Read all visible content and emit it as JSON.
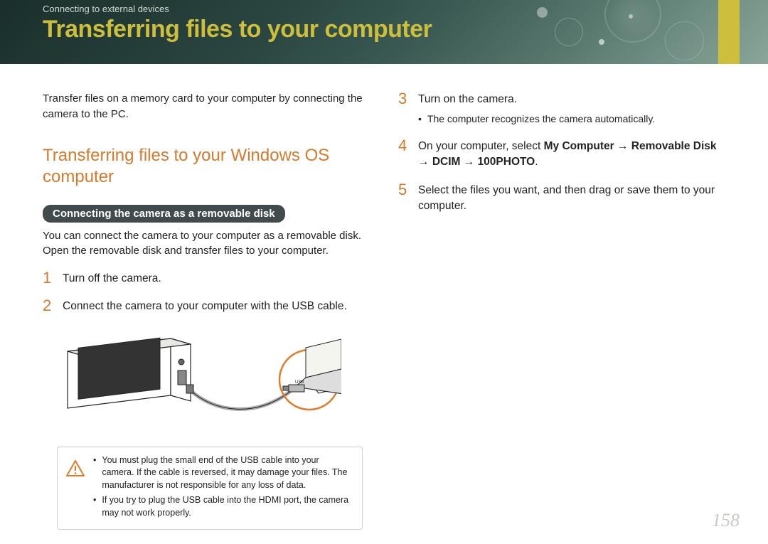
{
  "header": {
    "breadcrumb": "Connecting to external devices",
    "title": "Transferring files to your computer"
  },
  "left": {
    "intro": "Transfer files on a memory card to your computer by connecting the camera to the PC.",
    "subheading": "Transferring files to your Windows OS computer",
    "pill": "Connecting the camera as a removable disk",
    "pill_desc": "You can connect the camera to your computer as a removable disk. Open the removable disk and transfer files to your computer.",
    "step1": "Turn off the camera.",
    "step2": "Connect the camera to your computer with the USB cable.",
    "warn1": "You must plug the small end of the USB cable into your camera. If the cable is reversed, it may damage your files. The manufacturer is not responsible for any loss of data.",
    "warn2": "If you try to plug the USB cable into the HDMI port, the camera may not work properly."
  },
  "right": {
    "step3": "Turn on the camera.",
    "step3_sub": "The computer recognizes the camera automatically.",
    "step4_pre": "On your computer, select ",
    "step4_b1": "My Computer",
    "step4_arr": " → ",
    "step4_b2": "Removable Disk",
    "step4_b3": "DCIM",
    "step4_b4": "100PHOTO",
    "step4_end": ".",
    "step5": "Select the files you want, and then drag or save them to your computer."
  },
  "page": "158"
}
